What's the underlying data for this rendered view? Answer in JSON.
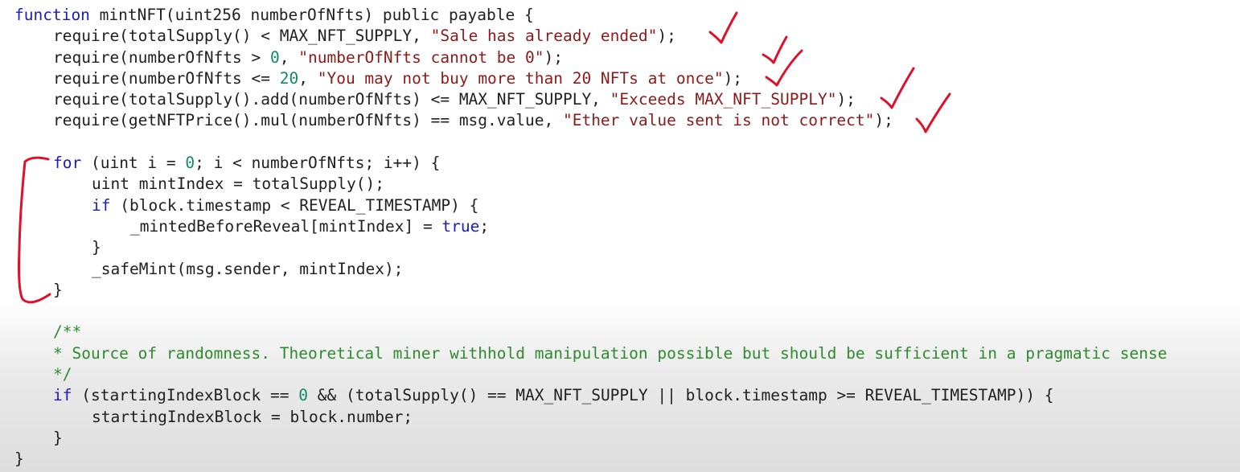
{
  "code_lines": [
    {
      "indent": 0,
      "tokens": [
        [
          "kw",
          "function"
        ],
        [
          "pl",
          " mintNFT(uint256 numberOfNfts) public payable {"
        ]
      ]
    },
    {
      "indent": 1,
      "tokens": [
        [
          "pl",
          "require(totalSupply() < MAX_NFT_SUPPLY, "
        ],
        [
          "str",
          "\"Sale has already ended\""
        ],
        [
          "pl",
          ");"
        ]
      ]
    },
    {
      "indent": 1,
      "tokens": [
        [
          "pl",
          "require(numberOfNfts > "
        ],
        [
          "num",
          "0"
        ],
        [
          "pl",
          ", "
        ],
        [
          "str",
          "\"numberOfNfts cannot be 0\""
        ],
        [
          "pl",
          ");"
        ]
      ]
    },
    {
      "indent": 1,
      "tokens": [
        [
          "pl",
          "require(numberOfNfts <= "
        ],
        [
          "num",
          "20"
        ],
        [
          "pl",
          ", "
        ],
        [
          "str",
          "\"You may not buy more than 20 NFTs at once\""
        ],
        [
          "pl",
          ");"
        ]
      ]
    },
    {
      "indent": 1,
      "tokens": [
        [
          "pl",
          "require(totalSupply().add(numberOfNfts) <= MAX_NFT_SUPPLY, "
        ],
        [
          "str",
          "\"Exceeds MAX_NFT_SUPPLY\""
        ],
        [
          "pl",
          ");"
        ]
      ]
    },
    {
      "indent": 1,
      "tokens": [
        [
          "pl",
          "require(getNFTPrice().mul(numberOfNfts) == msg.value, "
        ],
        [
          "str",
          "\"Ether value sent is not correct\""
        ],
        [
          "pl",
          ");"
        ]
      ]
    },
    {
      "indent": 0,
      "tokens": []
    },
    {
      "indent": 1,
      "tokens": [
        [
          "kw",
          "for"
        ],
        [
          "pl",
          " (uint i = "
        ],
        [
          "num",
          "0"
        ],
        [
          "pl",
          "; i < numberOfNfts; i++) {"
        ]
      ]
    },
    {
      "indent": 2,
      "tokens": [
        [
          "pl",
          "uint mintIndex = totalSupply();"
        ]
      ]
    },
    {
      "indent": 2,
      "tokens": [
        [
          "kw",
          "if"
        ],
        [
          "pl",
          " (block.timestamp < REVEAL_TIMESTAMP) {"
        ]
      ]
    },
    {
      "indent": 3,
      "tokens": [
        [
          "pl",
          "_mintedBeforeReveal[mintIndex] = "
        ],
        [
          "kw",
          "true"
        ],
        [
          "pl",
          ";"
        ]
      ]
    },
    {
      "indent": 2,
      "tokens": [
        [
          "pl",
          "}"
        ]
      ]
    },
    {
      "indent": 2,
      "tokens": [
        [
          "pl",
          "_safeMint(msg.sender, mintIndex);"
        ]
      ]
    },
    {
      "indent": 1,
      "tokens": [
        [
          "pl",
          "}"
        ]
      ]
    },
    {
      "indent": 0,
      "tokens": []
    },
    {
      "indent": 1,
      "tokens": [
        [
          "cm",
          "/**"
        ]
      ]
    },
    {
      "indent": 1,
      "tokens": [
        [
          "cm",
          "* Source of randomness. Theoretical miner withhold manipulation possible but should be sufficient in a pragmatic sense"
        ]
      ]
    },
    {
      "indent": 1,
      "tokens": [
        [
          "cm",
          "*/"
        ]
      ]
    },
    {
      "indent": 1,
      "tokens": [
        [
          "kw",
          "if"
        ],
        [
          "pl",
          " (startingIndexBlock == "
        ],
        [
          "num",
          "0"
        ],
        [
          "pl",
          " && (totalSupply() == MAX_NFT_SUPPLY || block.timestamp >= REVEAL_TIMESTAMP)) {"
        ]
      ]
    },
    {
      "indent": 2,
      "tokens": [
        [
          "pl",
          "startingIndexBlock = block.number;"
        ]
      ]
    },
    {
      "indent": 1,
      "tokens": [
        [
          "pl",
          "}"
        ]
      ]
    },
    {
      "indent": 0,
      "tokens": [
        [
          "pl",
          "}"
        ]
      ]
    }
  ],
  "annotation_color": "#e0102a",
  "annotations": {
    "checkmarks": "require-lines-1-5",
    "bracket": "for-loop"
  }
}
